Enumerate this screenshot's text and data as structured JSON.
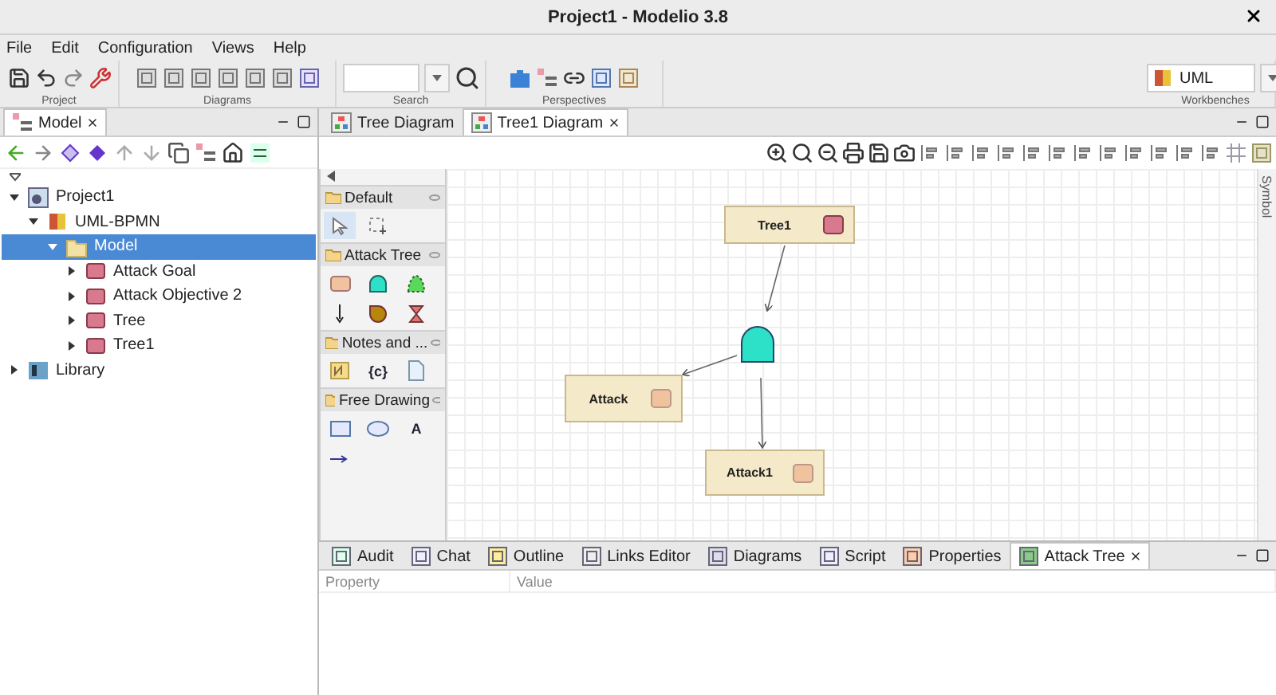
{
  "window": {
    "title": "Project1 - Modelio 3.8"
  },
  "menu": [
    "File",
    "Edit",
    "Configuration",
    "Views",
    "Help"
  ],
  "toolbar": {
    "groups": [
      {
        "label": "Project",
        "kind": "project"
      },
      {
        "label": "Diagrams",
        "kind": "diagrams"
      },
      {
        "label": "Search",
        "kind": "search"
      },
      {
        "label": "Perspectives",
        "kind": "perspectives"
      }
    ],
    "workbench": {
      "value": "UML",
      "label": "Workbenches"
    }
  },
  "model_panel": {
    "tab": "Model",
    "tree": [
      {
        "label": "Project1",
        "kind": "project",
        "expanded": true,
        "selected": false,
        "children": [
          {
            "label": "UML-BPMN",
            "kind": "module",
            "expanded": true,
            "selected": false,
            "children": [
              {
                "label": "Model",
                "kind": "folder",
                "expanded": true,
                "selected": true,
                "children": [
                  {
                    "label": "Attack Goal",
                    "kind": "element",
                    "expanded": false,
                    "selected": false
                  },
                  {
                    "label": "Attack Objective 2",
                    "kind": "element",
                    "expanded": false,
                    "selected": false
                  },
                  {
                    "label": "Tree",
                    "kind": "element",
                    "expanded": false,
                    "selected": false
                  },
                  {
                    "label": "Tree1",
                    "kind": "element",
                    "expanded": false,
                    "selected": false
                  }
                ]
              }
            ]
          }
        ]
      },
      {
        "label": "Library",
        "kind": "library",
        "expanded": false,
        "selected": false
      }
    ]
  },
  "editor": {
    "tabs": [
      {
        "label": "Tree Diagram",
        "selected": false
      },
      {
        "label": "Tree1 Diagram",
        "selected": true
      }
    ],
    "palette": [
      {
        "title": "Default",
        "tools": [
          {
            "kind": "pointer",
            "selected": true
          },
          {
            "kind": "marquee",
            "selected": false
          }
        ]
      },
      {
        "title": "Attack Tree",
        "tools": [
          {
            "kind": "attack",
            "selected": false
          },
          {
            "kind": "and-gate",
            "selected": false
          },
          {
            "kind": "or-gate",
            "selected": false
          },
          {
            "kind": "link",
            "selected": false
          },
          {
            "kind": "circle",
            "selected": false
          },
          {
            "kind": "hourglass",
            "selected": false
          }
        ]
      },
      {
        "title": "Notes and ...",
        "tools": [
          {
            "kind": "note",
            "selected": false
          },
          {
            "kind": "glyph",
            "text": "{c}",
            "selected": false
          },
          {
            "kind": "document",
            "selected": false
          }
        ]
      },
      {
        "title": "Free Drawing",
        "tools": [
          {
            "kind": "rectangle",
            "selected": false
          },
          {
            "kind": "ellipse",
            "selected": false
          },
          {
            "kind": "glyph",
            "text": "A",
            "selected": false
          },
          {
            "kind": "arrow",
            "selected": false
          }
        ]
      }
    ],
    "diagram": {
      "nodes": [
        {
          "label": "Tree1",
          "kind": "tree"
        },
        {
          "kind": "and-gate"
        },
        {
          "label": "Attack",
          "kind": "attack"
        },
        {
          "label": "Attack1",
          "kind": "attack"
        }
      ]
    },
    "side_label": "Symbol"
  },
  "bottom_panel": {
    "tabs": [
      {
        "label": "Audit",
        "selected": false
      },
      {
        "label": "Chat",
        "selected": false
      },
      {
        "label": "Outline",
        "selected": false
      },
      {
        "label": "Links Editor",
        "selected": false
      },
      {
        "label": "Diagrams",
        "selected": false
      },
      {
        "label": "Script",
        "selected": false
      },
      {
        "label": "Properties",
        "selected": false
      },
      {
        "label": "Attack Tree",
        "selected": true
      }
    ],
    "columns": [
      "Property",
      "Value"
    ]
  }
}
